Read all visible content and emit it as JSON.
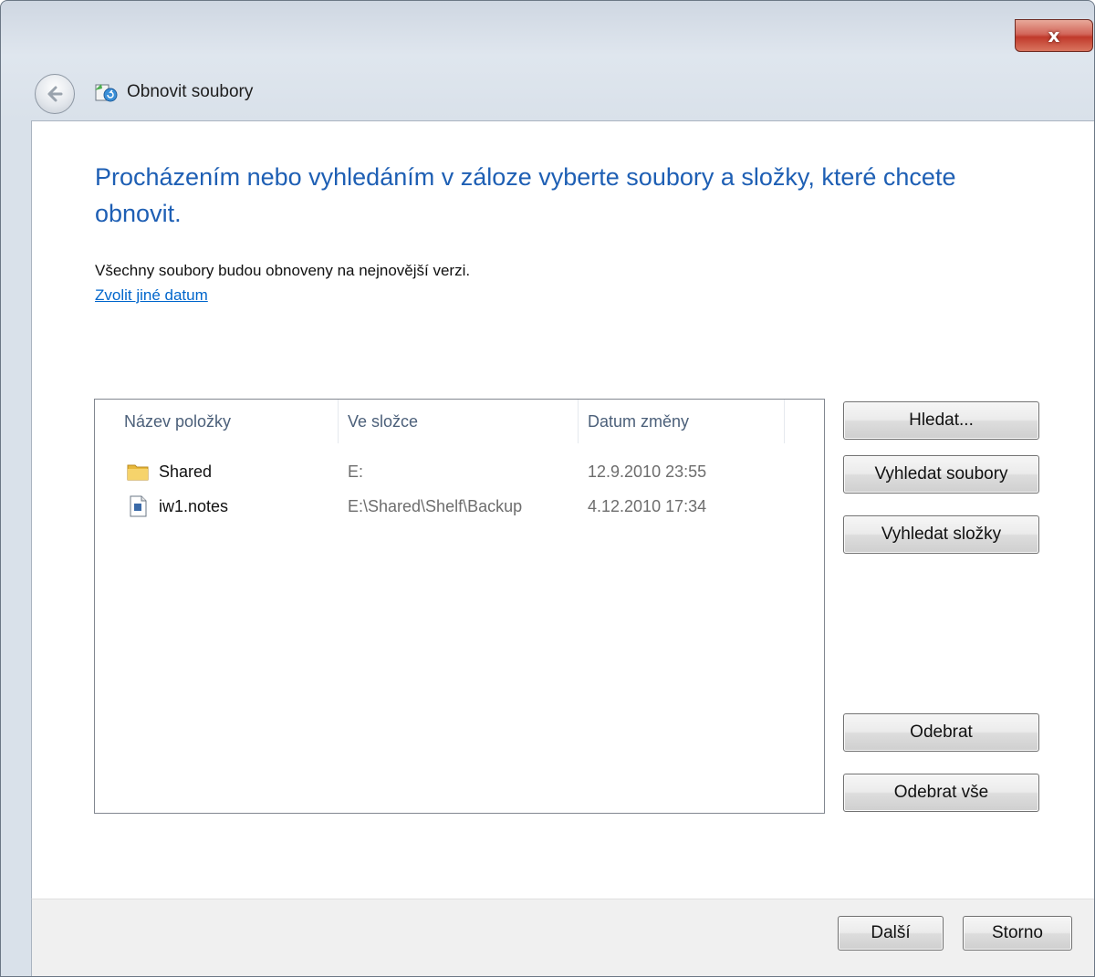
{
  "window": {
    "title": "Obnovit soubory",
    "close_label": "x"
  },
  "icons": {
    "back": "back-arrow-icon",
    "title": "restore-files-icon",
    "folder": "folder-icon",
    "file": "document-icon"
  },
  "main": {
    "heading": "Procházením nebo vyhledáním v záloze vyberte soubory a složky, které chcete obnovit.",
    "description": "Všechny soubory budou obnoveny na nejnovější verzi.",
    "link": "Zvolit jiné datum"
  },
  "list": {
    "columns": [
      "Název položky",
      "Ve složce",
      "Datum změny"
    ],
    "rows": [
      {
        "name": "Shared",
        "folder": "E:",
        "date": "12.9.2010 23:55",
        "icon": "folder-icon"
      },
      {
        "name": "iw1.notes",
        "folder": "E:\\Shared\\Shelf\\Backup",
        "date": "4.12.2010 17:34",
        "icon": "document-icon"
      }
    ]
  },
  "side_buttons": {
    "search": "Hledat...",
    "search_files": "Vyhledat soubory",
    "search_folders": "Vyhledat složky",
    "remove": "Odebrat",
    "remove_all": "Odebrat vše"
  },
  "footer": {
    "next": "Další",
    "cancel": "Storno"
  },
  "colors": {
    "heading": "#1e5fb4",
    "link": "#0066cc",
    "close_button": "#c0392b"
  }
}
